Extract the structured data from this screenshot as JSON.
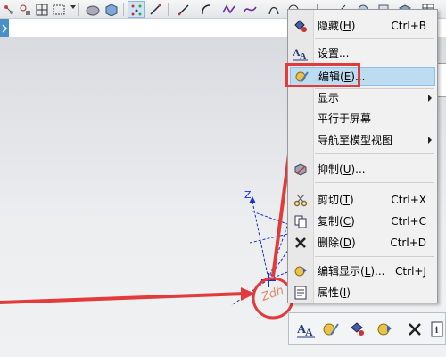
{
  "context_menu": {
    "items": [
      {
        "label": "隐藏(",
        "key": "H",
        "suffix": ")",
        "shortcut": "Ctrl+B"
      },
      {
        "label": "设置..."
      },
      {
        "label": "编辑(",
        "key": "E",
        "suffix": ")...",
        "highlighted": true
      },
      {
        "label": "显示",
        "submenu": true
      },
      {
        "label": "平行于屏幕"
      },
      {
        "label": "导航至模型视图",
        "submenu": true
      },
      {
        "label": "抑制(",
        "key": "U",
        "suffix": ")..."
      },
      {
        "label": "剪切(",
        "key": "T",
        "suffix": ")",
        "shortcut": "Ctrl+X"
      },
      {
        "label": "复制(",
        "key": "C",
        "suffix": ")",
        "shortcut": "Ctrl+C"
      },
      {
        "label": "删除(",
        "key": "D",
        "suffix": ")",
        "shortcut": "Ctrl+D"
      },
      {
        "label": "编辑显示(",
        "key": "L",
        "suffix": ")...",
        "shortcut": "Ctrl+J"
      },
      {
        "label": "属性(",
        "key": "I",
        "suffix": ")"
      }
    ]
  },
  "viewport": {
    "axis_label_z": "Z",
    "annotation_text": "Zdh"
  },
  "colors": {
    "annotation_red": "#e33b3b",
    "menu_highlight": "#bcdcf2",
    "axis_blue": "#1a2fd0"
  }
}
